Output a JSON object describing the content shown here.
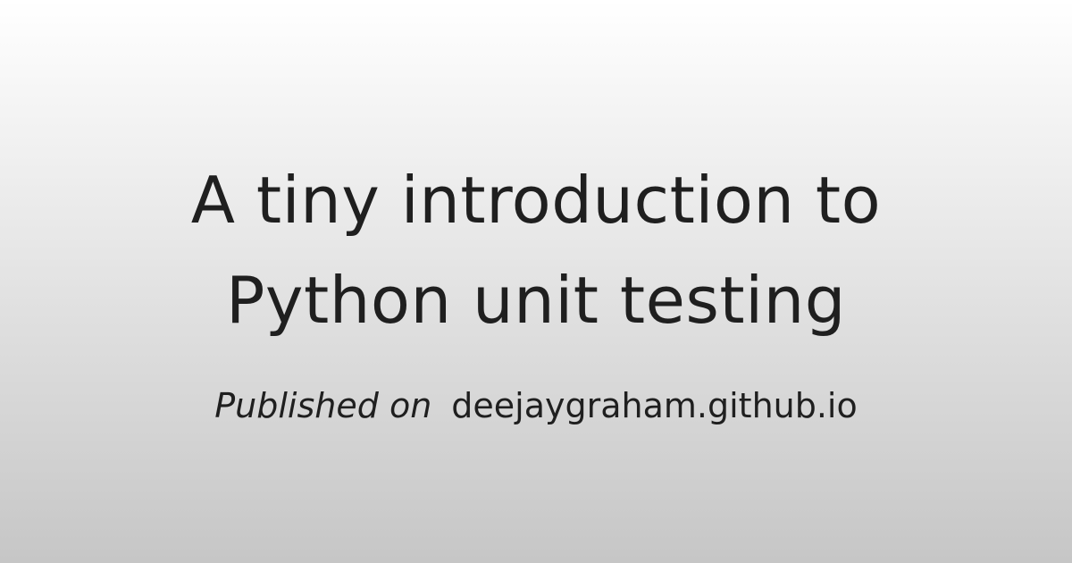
{
  "card": {
    "title_line_1": "A tiny introduction to",
    "title_line_2": "Python unit testing",
    "byline_prefix": "Published on",
    "byline_site": "deejaygraham.github.io"
  },
  "colors": {
    "background_top": "#ffffff",
    "background_bottom": "#c6c6c6",
    "text": "#1f1f1f"
  }
}
